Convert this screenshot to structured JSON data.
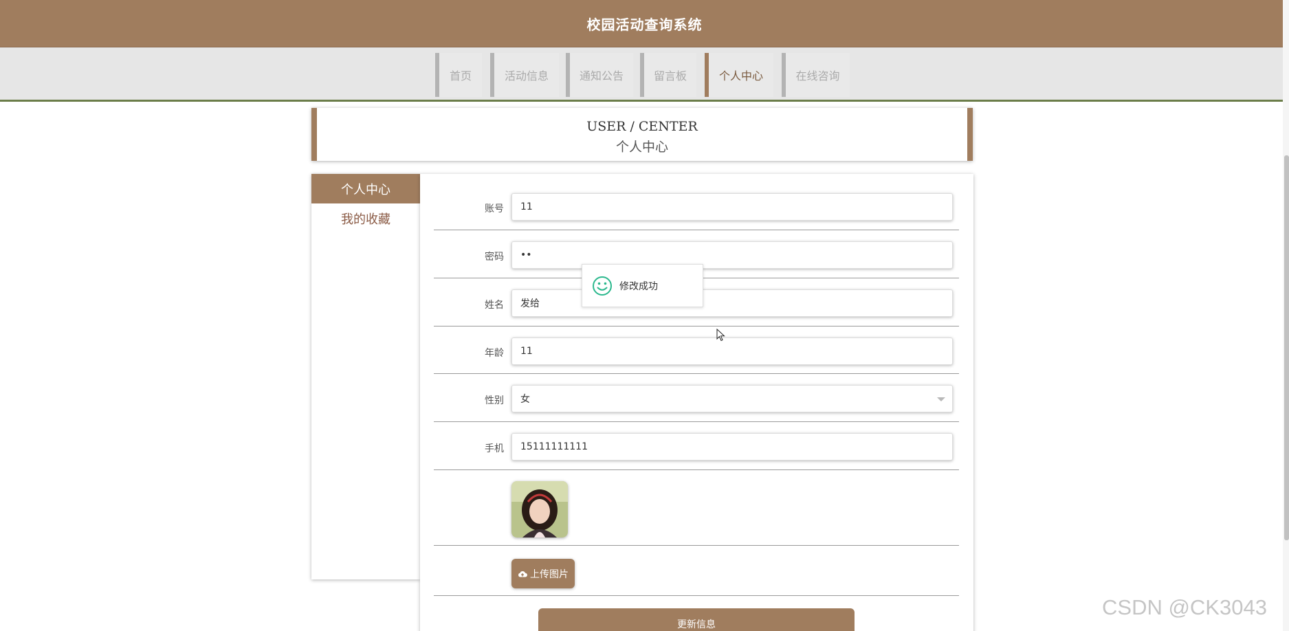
{
  "app": {
    "title": "校园活动查询系统"
  },
  "nav": {
    "items": [
      {
        "label": "首页"
      },
      {
        "label": "活动信息"
      },
      {
        "label": "通知公告"
      },
      {
        "label": "留言板"
      },
      {
        "label": "个人中心"
      },
      {
        "label": "在线咨询"
      }
    ],
    "active_index": 4
  },
  "page_header": {
    "title_en": "USER / CENTER",
    "title_cn": "个人中心"
  },
  "sidebar": {
    "items": [
      {
        "label": "个人中心"
      },
      {
        "label": "我的收藏"
      }
    ],
    "active_index": 0
  },
  "form": {
    "account": {
      "label": "账号",
      "value": "11"
    },
    "password": {
      "label": "密码",
      "value": "••"
    },
    "name": {
      "label": "姓名",
      "value": "发给"
    },
    "age": {
      "label": "年龄",
      "value": "11"
    },
    "gender": {
      "label": "性别",
      "value": "女"
    },
    "phone": {
      "label": "手机",
      "value": "15111111111"
    },
    "upload_label": "上传图片",
    "submit_label": "更新信息"
  },
  "toast": {
    "message": "修改成功"
  },
  "watermark": "CSDN @CK3043",
  "colors": {
    "accent": "#a07d5e",
    "toast_icon": "#2bb88d",
    "nav_background": "#e6e6e6"
  }
}
